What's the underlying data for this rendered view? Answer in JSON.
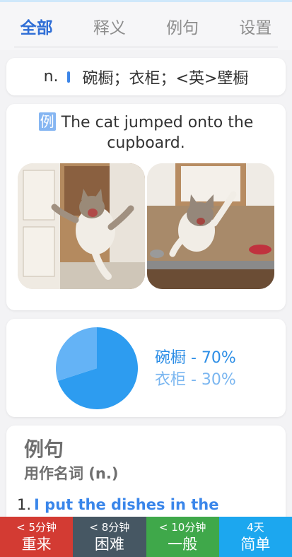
{
  "tabs": [
    {
      "label": "全部",
      "active": true
    },
    {
      "label": "释义",
      "active": false
    },
    {
      "label": "例句",
      "active": false
    },
    {
      "label": "设置",
      "active": false
    }
  ],
  "definition": {
    "pos": "n.",
    "text": "碗橱；衣柜；<英>壁橱"
  },
  "example": {
    "badge": "例",
    "sentence": "The cat jumped onto the cupboard."
  },
  "chart_data": {
    "type": "pie",
    "slices": [
      {
        "label": "碗橱",
        "value": 70,
        "display": "碗橱 - 70%",
        "color": "#2d9cf0"
      },
      {
        "label": "衣柜",
        "value": 30,
        "display": "衣柜 - 30%",
        "color": "#64b3f6"
      }
    ]
  },
  "sentences": {
    "title": "例句",
    "subtitle": "用作名词 (n.)",
    "items": [
      {
        "num": "1.",
        "text": "I put the dishes in the"
      }
    ]
  },
  "review_buttons": [
    {
      "time": "< 5分钟",
      "label": "重来",
      "color": "#d33b33"
    },
    {
      "time": "< 8分钟",
      "label": "困难",
      "color": "#465763"
    },
    {
      "time": "< 10分钟",
      "label": "一般",
      "color": "#3fa84a"
    },
    {
      "time": "4天",
      "label": "简单",
      "color": "#1ca7ef"
    }
  ]
}
